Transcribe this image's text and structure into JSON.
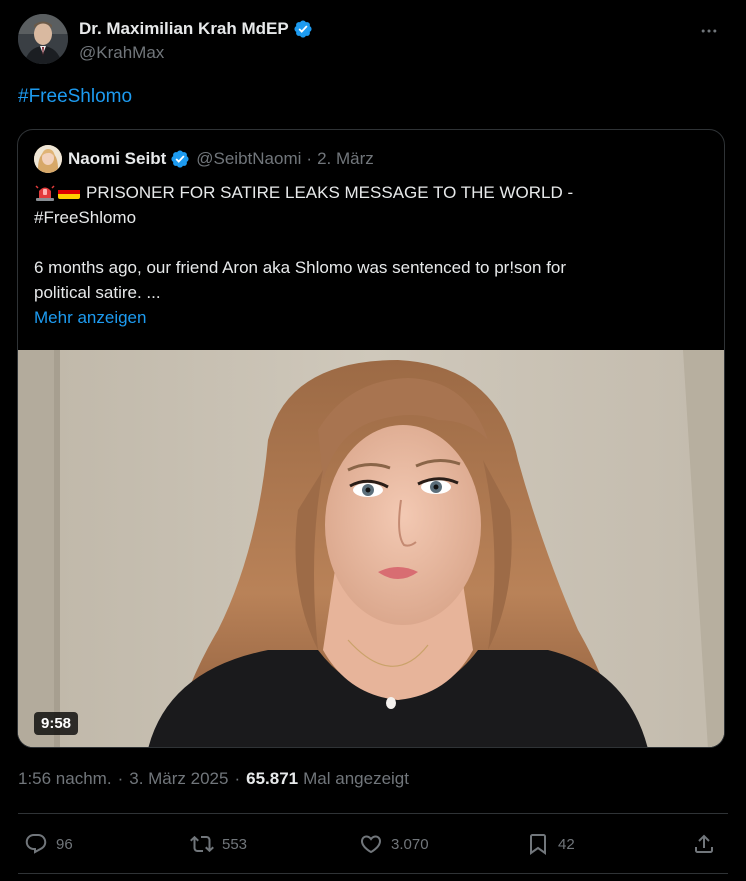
{
  "tweet": {
    "author_name": "Dr. Maximilian Krah MdEP",
    "author_handle": "@KrahMax",
    "text": "#FreeShlomo"
  },
  "quote": {
    "name": "Naomi Seibt",
    "handle": "@SeibtNaomi",
    "separator": "·",
    "date": "2. März",
    "line1": "PRISONER FOR SATIRE LEAKS MESSAGE TO THE WORLD -",
    "line2": "#FreeShlomo",
    "line3": "6 months ago, our friend Aron aka Shlomo was sentenced to pr!son for",
    "line4": "political satire. ...",
    "show_more": "Mehr anzeigen",
    "video_duration": "9:58"
  },
  "meta": {
    "time": "1:56 nachm.",
    "separator": "·",
    "date": "3. März 2025",
    "views": "65.871",
    "views_label": "Mal angezeigt"
  },
  "actions": {
    "replies": "96",
    "reposts": "553",
    "likes": "3.070",
    "bookmarks": "42"
  },
  "icons": [
    "verified-badge-icon",
    "more-icon",
    "siren-emoji-icon",
    "germany-flag-emoji-icon",
    "reply-icon",
    "repost-icon",
    "like-icon",
    "bookmark-icon",
    "share-icon"
  ],
  "colors": {
    "background": "#000000",
    "text": "#e7e9ea",
    "secondary": "#71767b",
    "link": "#1d9bf0",
    "border": "#2f3336"
  }
}
